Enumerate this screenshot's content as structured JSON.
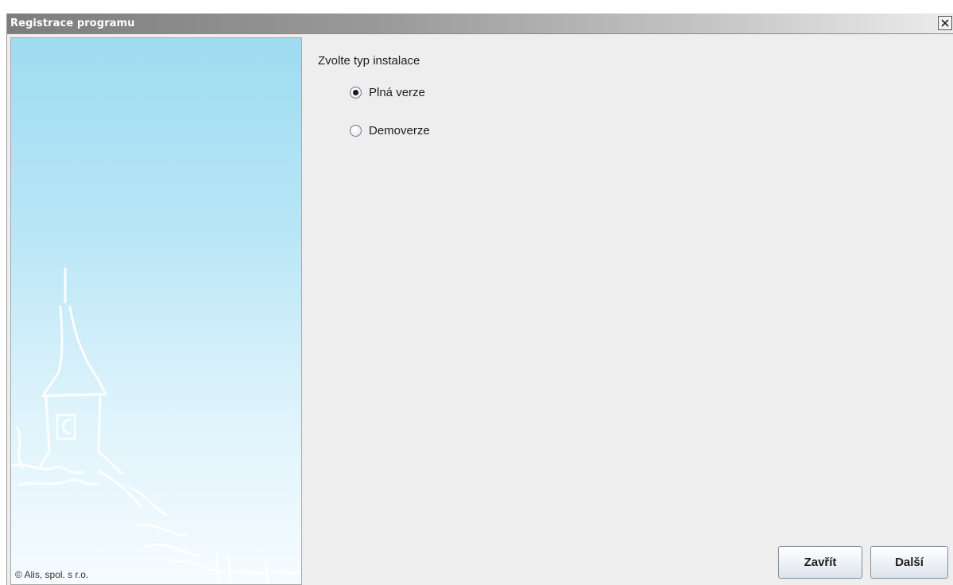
{
  "window": {
    "title": "Registrace programu",
    "close_glyph": "×"
  },
  "side_panel": {
    "copyright": "© Alis, spol. s r.o."
  },
  "install_type": {
    "title": "Zvolte typ instalace",
    "options": [
      {
        "label": "Plná verze",
        "selected": true
      },
      {
        "label": "Demoverze",
        "selected": false
      }
    ]
  },
  "buttons": {
    "close_label": "Zavřít",
    "next_label": "Další"
  },
  "colors": {
    "titlebar_start": "#7d7d7d",
    "panel_sky_top": "#9edcf1",
    "dialog_background": "#eeeeee"
  }
}
